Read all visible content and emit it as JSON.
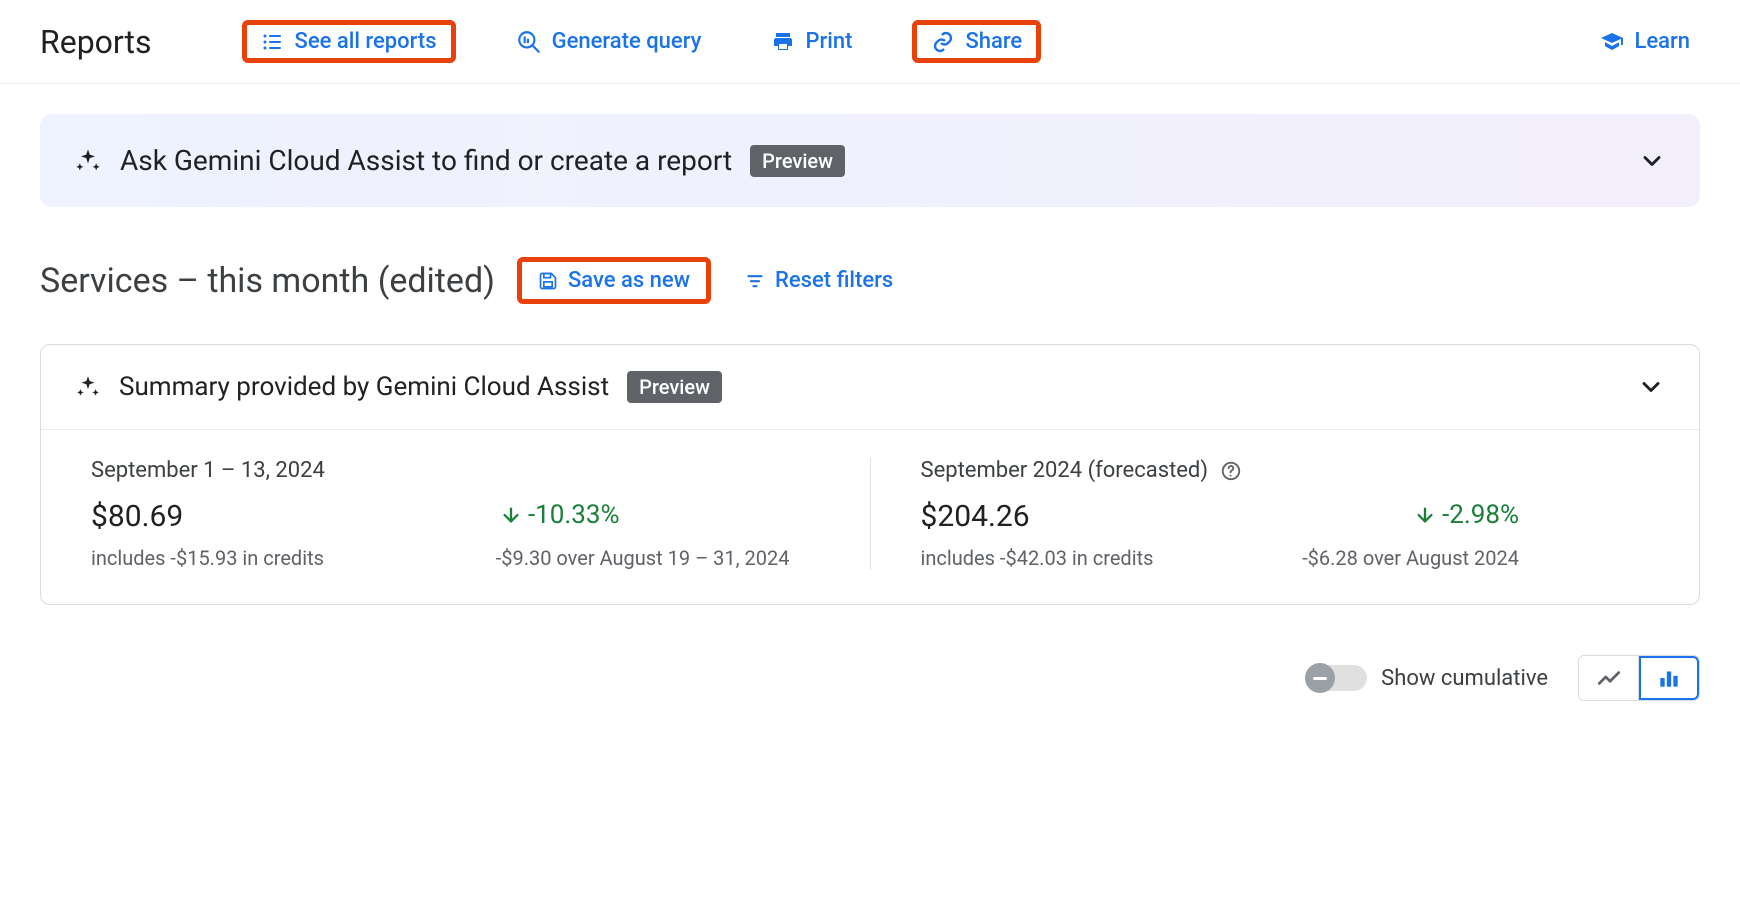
{
  "toolbar": {
    "page_title": "Reports",
    "see_all_reports": "See all reports",
    "generate_query": "Generate query",
    "print": "Print",
    "share": "Share",
    "learn": "Learn"
  },
  "gemini_banner": {
    "title": "Ask Gemini Cloud Assist to find or create a report",
    "badge": "Preview"
  },
  "report": {
    "name": "Services – this month (edited)",
    "save_as_new": "Save as new",
    "reset_filters": "Reset filters"
  },
  "summary": {
    "title": "Summary provided by Gemini Cloud Assist",
    "badge": "Preview",
    "left": {
      "period": "September 1 – 13, 2024",
      "amount": "$80.69",
      "delta_pct": "-10.33%",
      "credits": "includes -$15.93 in credits",
      "over": "-$9.30 over August 19 – 31, 2024"
    },
    "right": {
      "period": "September 2024 (forecasted)",
      "amount": "$204.26",
      "delta_pct": "-2.98%",
      "credits": "includes -$42.03 in credits",
      "over": "-$6.28 over August 2024"
    }
  },
  "footer": {
    "show_cumulative": "Show cumulative"
  }
}
